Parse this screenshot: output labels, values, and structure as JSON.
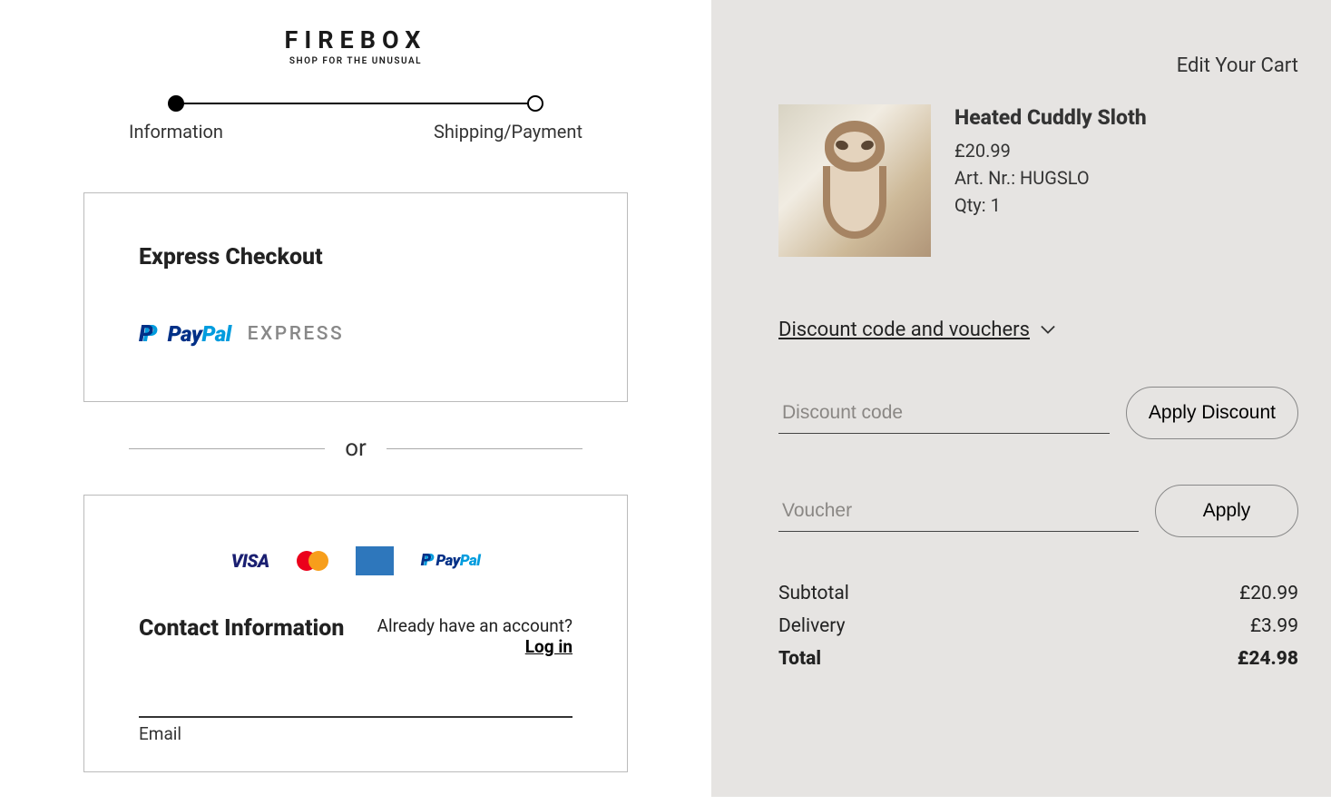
{
  "logo": {
    "title": "FIREBOX",
    "subtitle": "SHOP FOR THE UNUSUAL"
  },
  "progress": {
    "info_label": "Information",
    "ship_label": "Shipping/Payment"
  },
  "express": {
    "title": "Express Checkout",
    "paypal_pay": "Pay",
    "paypal_pal": "Pal",
    "paypal_express": "EXPRESS"
  },
  "or_label": "or",
  "contact": {
    "title": "Contact Information",
    "already_label": "Already have an account?",
    "login_label": "Log in",
    "email_label": "Email"
  },
  "payicons": {
    "visa": "VISA",
    "amex": "AMERICAN EXPRESS",
    "paypal_pay": "Pay",
    "paypal_pal": "Pal"
  },
  "cart": {
    "edit_label": "Edit Your Cart",
    "item": {
      "name": "Heated Cuddly Sloth",
      "price": "£20.99",
      "art": "Art. Nr.: HUGSLO",
      "qty": "Qty: 1"
    },
    "discount_toggle": "Discount code and vouchers",
    "discount_placeholder": "Discount code",
    "apply_discount_label": "Apply Discount",
    "voucher_placeholder": "Voucher",
    "apply_label": "Apply",
    "subtotal_label": "Subtotal",
    "subtotal_value": "£20.99",
    "delivery_label": "Delivery",
    "delivery_value": "£3.99",
    "total_label": "Total",
    "total_value": "£24.98"
  }
}
